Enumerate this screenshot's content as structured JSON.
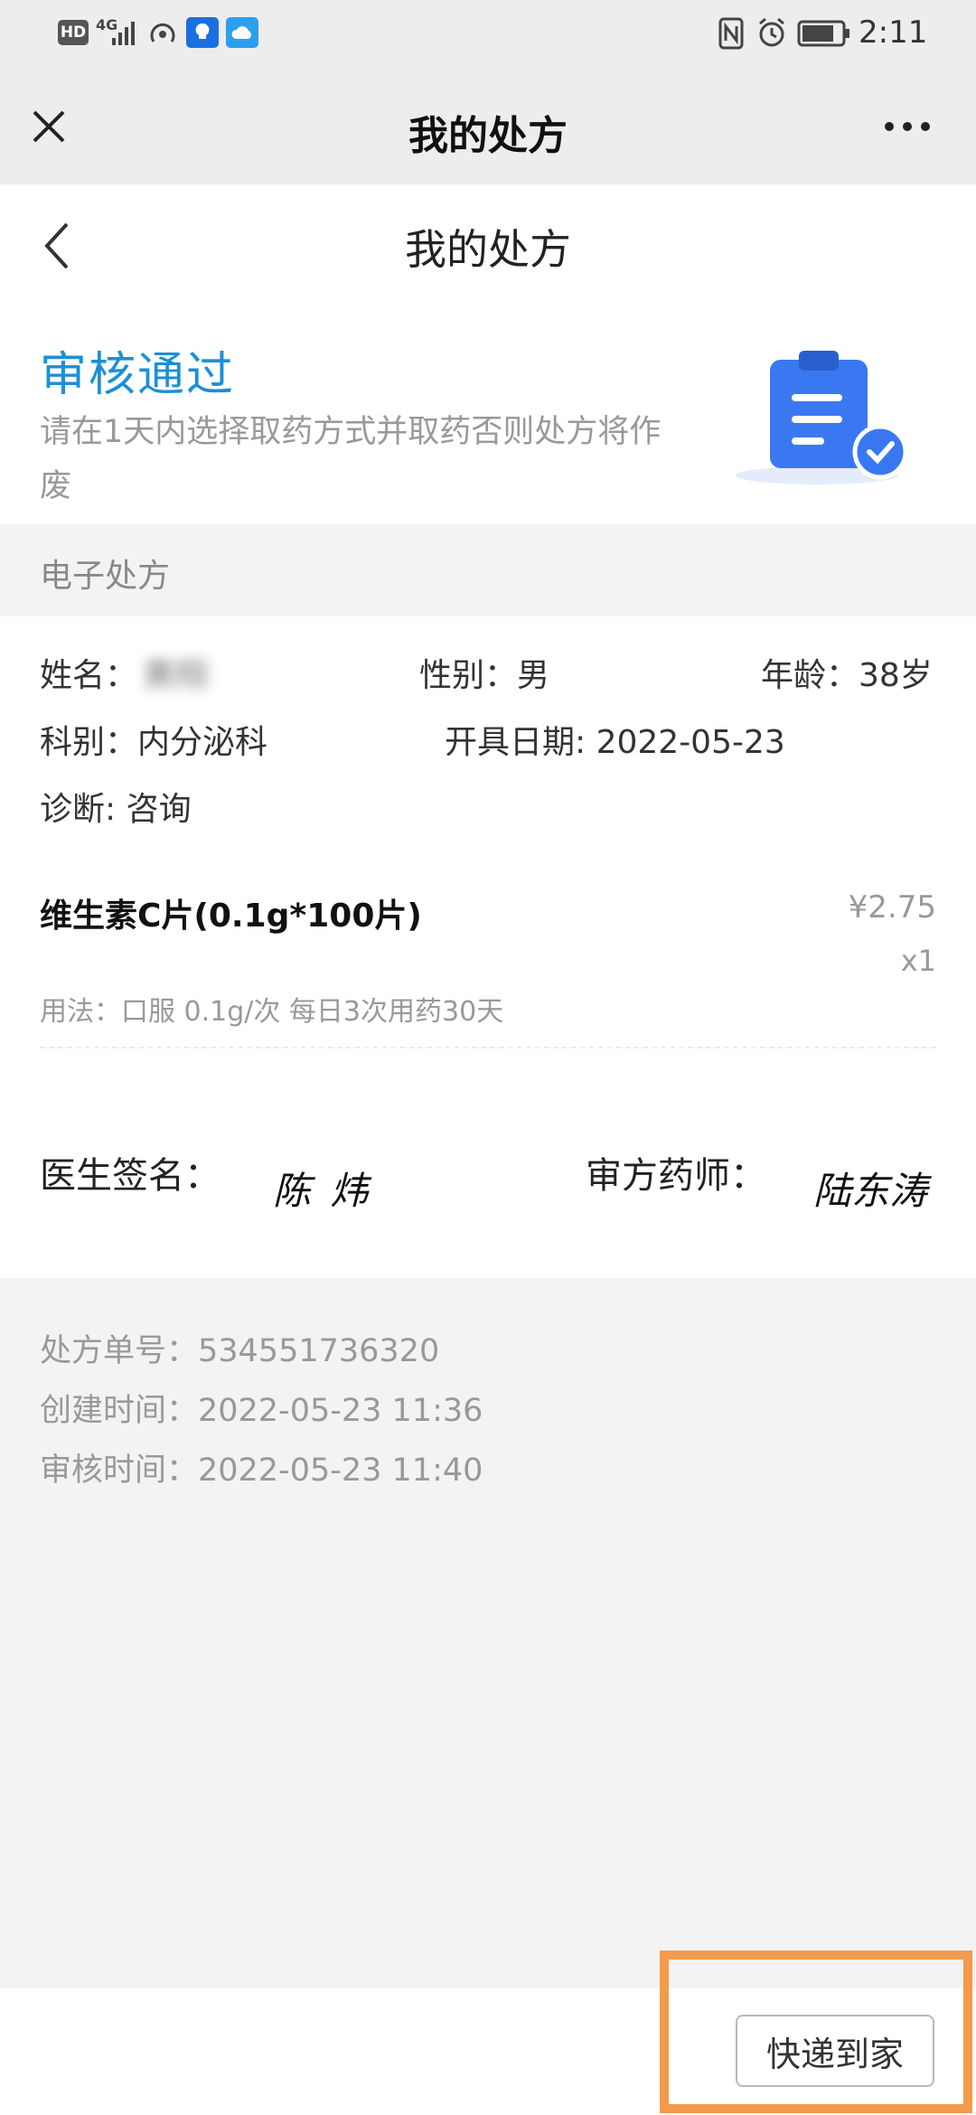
{
  "status_bar": {
    "hd": "HD",
    "network": "4G",
    "time": "2:11"
  },
  "wechat_bar": {
    "title": "我的处方"
  },
  "page": {
    "title": "我的处方"
  },
  "review": {
    "status": "审核通过",
    "notice": "请在1天内选择取药方式并取药否则处方将作废"
  },
  "section": {
    "label": "电子处方"
  },
  "patient": {
    "name_label": "姓名：",
    "name_value": "黄翔",
    "gender": "性别：男",
    "age": "年龄：38岁",
    "department": "科别：内分泌科",
    "date": "开具日期: 2022-05-23",
    "diagnosis": "诊断: 咨询"
  },
  "drug": {
    "name": "维生素C片(0.1g*100片)",
    "price": "¥2.75",
    "quantity": "x1",
    "usage": "用法：口服 0.1g/次  每日3次用药30天"
  },
  "signature": {
    "doctor_label": "医生签名：",
    "doctor_name": "陈 炜",
    "pharmacist_label": "审方药师：",
    "pharmacist_name": "陆东涛"
  },
  "meta": {
    "order_no": "处方单号：534551736320",
    "created": "创建时间：2022-05-23 11:36",
    "reviewed": "审核时间：2022-05-23 11:40"
  },
  "actions": {
    "express_label": "快递到家"
  },
  "colors": {
    "accent_blue": "#1b8fd8",
    "highlight_orange": "#f39a4c",
    "icon_blue": "#3a78f2"
  }
}
